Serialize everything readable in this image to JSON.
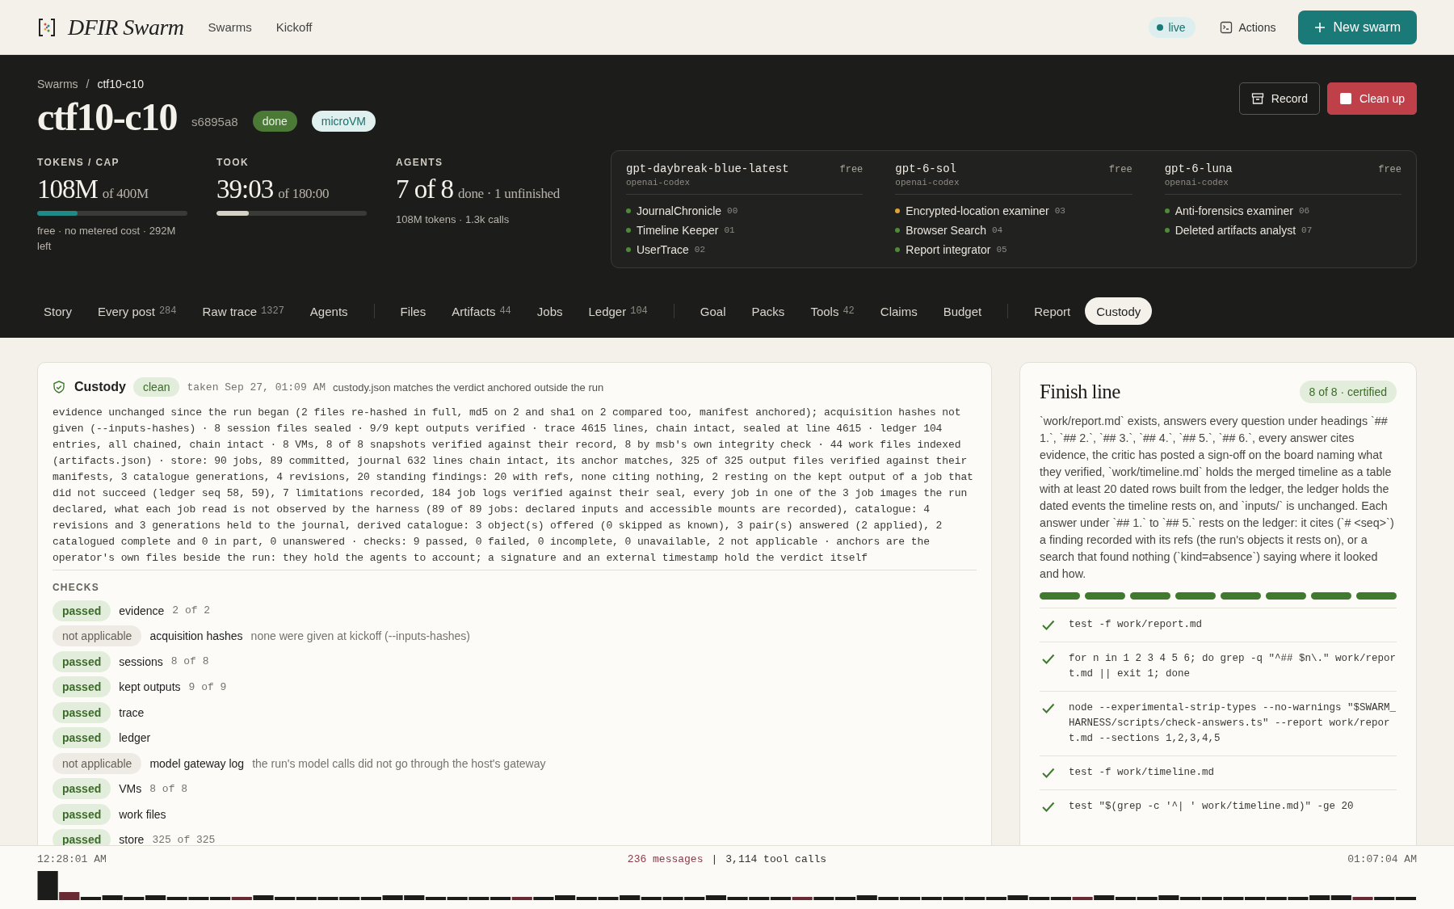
{
  "nav": {
    "brand": "DFIR Swarm",
    "links": [
      {
        "label": "Swarms"
      },
      {
        "label": "Kickoff"
      }
    ],
    "live": "live",
    "actions": "Actions",
    "new_button": "New swarm"
  },
  "hero": {
    "breadcrumb": [
      {
        "label": "Swarms"
      },
      {
        "label": "ctf10-c10"
      }
    ],
    "separator": "/",
    "title": "ctf10-c10",
    "hash": "s6895a8",
    "badges": [
      {
        "label": "done",
        "kind": "status"
      },
      {
        "label": "microVM",
        "kind": "runtime"
      }
    ],
    "buttons": [
      {
        "label": "Record",
        "kind": "outline"
      },
      {
        "label": "Clean up",
        "kind": "danger"
      }
    ],
    "stats": [
      {
        "label": "TOKENS / CAP",
        "value": "108M",
        "of": "of 400M",
        "kind": "tokens",
        "level": 0.27,
        "note": "free · no metered cost · 292M left"
      },
      {
        "label": "TOOK",
        "value": "39:03",
        "of": "of 180:00",
        "kind": "time",
        "level": 0.217
      },
      {
        "label": "AGENTS",
        "value": "7 of 8",
        "of": "done · 1 unfinished",
        "kind": "count",
        "note": "108M tokens · 1.3k calls"
      }
    ],
    "models": [
      {
        "name": "gpt-daybreak-blue-latest",
        "price": "free",
        "provider": "openai-codex",
        "agents": [
          {
            "name": "JournalChronicle",
            "number": "00",
            "color": "#4e8a3a"
          },
          {
            "name": "Timeline Keeper",
            "number": "01",
            "color": "#4e8a3a"
          },
          {
            "name": "UserTrace",
            "number": "02",
            "color": "#4e8a3a"
          }
        ]
      },
      {
        "name": "gpt-6-sol",
        "price": "free",
        "provider": "openai-codex",
        "agents": [
          {
            "name": "Encrypted-location examiner",
            "number": "03",
            "color": "#e0a238"
          },
          {
            "name": "Browser Search",
            "number": "04",
            "color": "#4e8a3a"
          },
          {
            "name": "Report integrator",
            "number": "05",
            "color": "#4e8a3a"
          }
        ]
      },
      {
        "name": "gpt-6-luna",
        "price": "free",
        "provider": "openai-codex",
        "agents": [
          {
            "name": "Anti-forensics examiner",
            "number": "06",
            "color": "#4e8a3a"
          },
          {
            "name": "Deleted artifacts analyst",
            "number": "07",
            "color": "#4e8a3a"
          }
        ]
      }
    ],
    "tab_groups": [
      {
        "tabs": [
          {
            "label": "Story",
            "selected": false
          },
          {
            "label": "Every post",
            "count": "284",
            "selected": false
          },
          {
            "label": "Raw trace",
            "count": "1327",
            "selected": false
          },
          {
            "label": "Agents",
            "selected": false
          }
        ]
      },
      {
        "tabs": [
          {
            "label": "Files",
            "selected": false
          },
          {
            "label": "Artifacts",
            "count": "44",
            "selected": false
          },
          {
            "label": "Jobs",
            "selected": false
          },
          {
            "label": "Ledger",
            "count": "104",
            "selected": false
          }
        ]
      },
      {
        "tabs": [
          {
            "label": "Goal",
            "selected": false
          },
          {
            "label": "Packs",
            "selected": false
          },
          {
            "label": "Tools",
            "count": "42",
            "selected": false
          },
          {
            "label": "Claims",
            "selected": false
          },
          {
            "label": "Budget",
            "selected": false
          }
        ]
      },
      {
        "tabs": [
          {
            "label": "Report",
            "selected": false
          },
          {
            "label": "Custody",
            "selected": true
          }
        ]
      }
    ]
  },
  "custody": {
    "title": "Custody",
    "badge": "clean",
    "taken": "taken Sep 27, 01:09 AM",
    "headline": "custody.json matches the verdict anchored outside the run",
    "summary": "evidence unchanged since the run began (2 files re-hashed in full, md5 on 2 and sha1 on 2 compared too, manifest anchored); acquisition hashes not given (--inputs-hashes) · 8 session files sealed · 9/9 kept outputs verified · trace 4615 lines, chain intact, sealed at line 4615 · ledger 104 entries, all chained, chain intact · 8 VMs, 8 of 8 snapshots verified against their record, 8 by msb's own integrity check · 44 work files indexed (artifacts.json) · store: 90 jobs, 89 committed, journal 632 lines chain intact, its anchor matches, 325 of 325 output files verified against their manifests, 3 catalogue generations, 4 revisions, 20 standing findings: 20 with refs, none citing nothing, 2 resting on the kept output of a job that did not succeed (ledger seq 58, 59), 7 limitations recorded, 184 job logs verified against their seal, every job in one of the 3 job images the run declared, what each job read is not observed by the harness (89 of 89 jobs: declared inputs and accessible mounts are recorded), catalogue: 4 revisions and 3 generations held to the journal, derived catalogue: 3 object(s) offered (0 skipped as known), 3 pair(s) answered (2 applied), 2 catalogued complete and 0 in part, 0 unanswered · checks: 9 passed, 0 failed, 0 incomplete, 0 unavailable, 2 not applicable · anchors are the operator's own files beside the run: they hold the agents to account; a signature and an external timestamp hold the verdict itself",
    "checks_label": "CHECKS",
    "checks": [
      {
        "status": "passed",
        "kind": "pass",
        "name": "evidence",
        "count": "2 of 2"
      },
      {
        "status": "not applicable",
        "kind": "na",
        "name": "acquisition hashes",
        "note": "none were given at kickoff (--inputs-hashes)"
      },
      {
        "status": "passed",
        "kind": "pass",
        "name": "sessions",
        "count": "8 of 8"
      },
      {
        "status": "passed",
        "kind": "pass",
        "name": "kept outputs",
        "count": "9 of 9"
      },
      {
        "status": "passed",
        "kind": "pass",
        "name": "trace"
      },
      {
        "status": "passed",
        "kind": "pass",
        "name": "ledger"
      },
      {
        "status": "not applicable",
        "kind": "na",
        "name": "model gateway log",
        "note": "the run's model calls did not go through the host's gateway"
      },
      {
        "status": "passed",
        "kind": "pass",
        "name": "VMs",
        "count": "8 of 8"
      },
      {
        "status": "passed",
        "kind": "pass",
        "name": "work files"
      },
      {
        "status": "passed",
        "kind": "pass",
        "name": "store",
        "count": "325 of 325"
      }
    ]
  },
  "finish": {
    "title": "Finish line",
    "badge": "8 of 8 · certified",
    "description": "`work/report.md` exists, answers every question under headings `## 1.`, `## 2.`, `## 3.`, `## 4.`, `## 5.`, `## 6.`, every answer cites evidence, the critic has posted a sign-off on the board naming what they verified, `work/timeline.md` holds the merged timeline as a table with at least 20 dated rows built from the ledger, the ledger holds the dated events the timeline rests on, and `inputs/` is unchanged. Each answer under `## 1.` to `## 5.` rests on the ledger: it cites (`# <seq>`) a finding recorded with its refs (the run's objects it rests on), or a search that found nothing (`kind=absence`) saying where it looked and how.",
    "segments": [
      {
        "done": true
      },
      {
        "done": true
      },
      {
        "done": true
      },
      {
        "done": true
      },
      {
        "done": true
      },
      {
        "done": true
      },
      {
        "done": true
      },
      {
        "done": true
      }
    ],
    "checks": [
      {
        "command": "test -f work/report.md",
        "passed": true
      },
      {
        "command": "for n in 1 2 3 4 5 6; do grep -q \"^## $n\\.\" work/report.md || exit 1; done",
        "passed": true
      },
      {
        "command": "node --experimental-strip-types --no-warnings \"$SWARM_HARNESS/scripts/check-answers.ts\" --report work/report.md --sections 1,2,3,4,5",
        "passed": true
      },
      {
        "command": "test -f work/timeline.md",
        "passed": true
      },
      {
        "command": "test \"$(grep -c '^| ' work/timeline.md)\" -ge 20",
        "passed": true
      }
    ]
  },
  "timeline": {
    "start": "12:28:01 AM",
    "messages": "236 messages",
    "separator": "|",
    "calls": "3,114 tool calls",
    "end": "01:07:04 AM"
  }
}
